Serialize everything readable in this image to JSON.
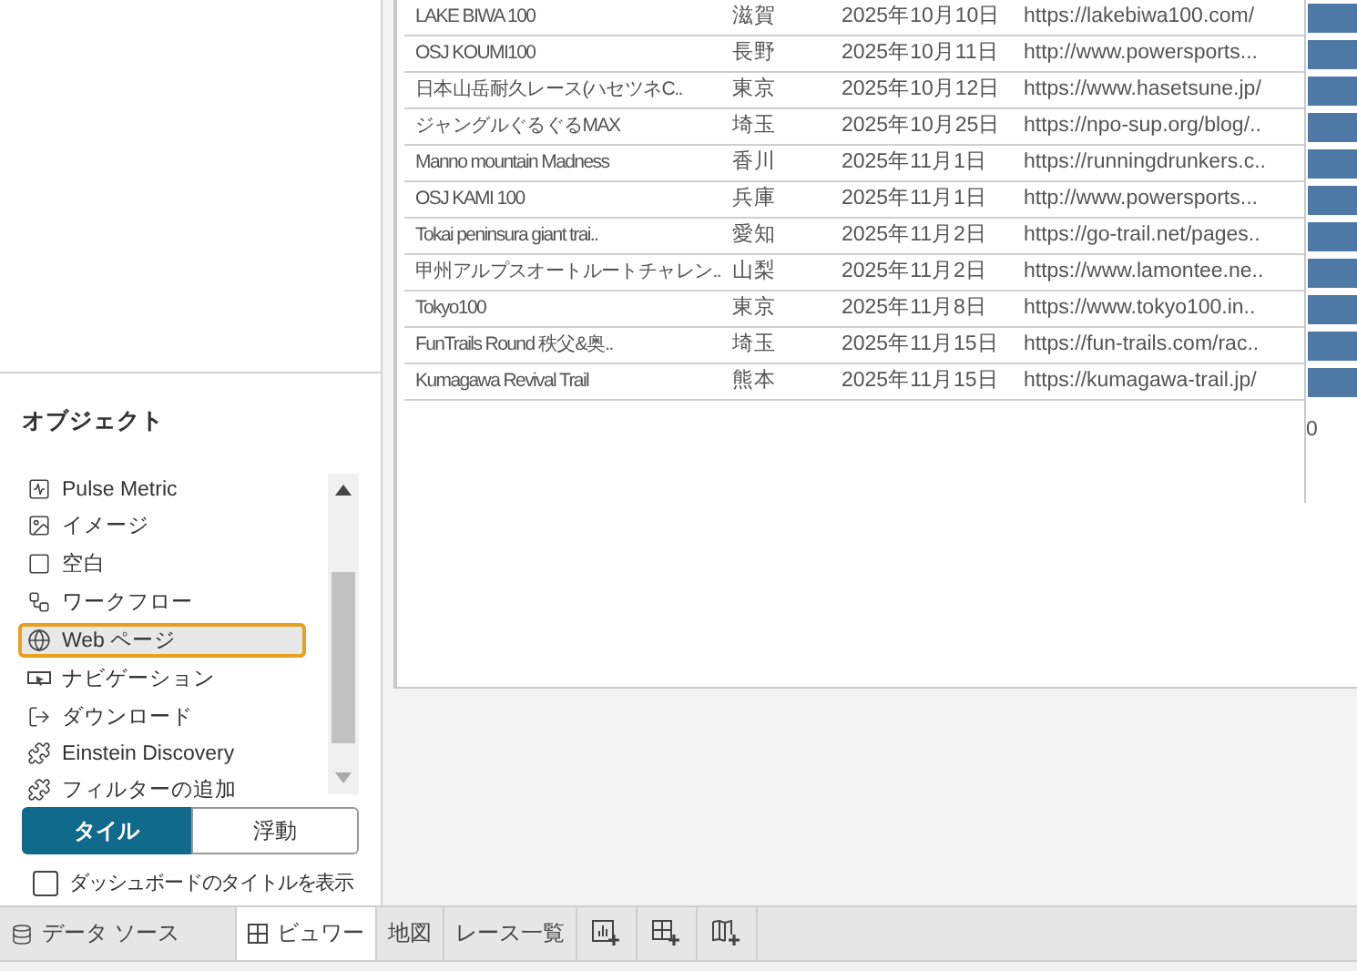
{
  "table": {
    "rows": [
      {
        "name": "LAKE BIWA 100",
        "prefecture": "滋賀",
        "date": "2025年10月10日",
        "url": "https://lakebiwa100.com/"
      },
      {
        "name": "OSJ KOUMI100",
        "prefecture": "長野",
        "date": "2025年10月11日",
        "url": "http://www.powersports..."
      },
      {
        "name": "日本山岳耐久レース(ハセツネC..",
        "prefecture": "東京",
        "date": "2025年10月12日",
        "url": "https://www.hasetsune.jp/"
      },
      {
        "name": "ジャングルぐるぐるMAX",
        "prefecture": "埼玉",
        "date": "2025年10月25日",
        "url": "https://npo-sup.org/blog/.."
      },
      {
        "name": "Manno mountain Madness",
        "prefecture": "香川",
        "date": "2025年11月1日",
        "url": "https://runningdrunkers.c.."
      },
      {
        "name": "OSJ KAMI 100",
        "prefecture": "兵庫",
        "date": "2025年11月1日",
        "url": "http://www.powersports..."
      },
      {
        "name": "Tokai peninsura giant trai..",
        "prefecture": "愛知",
        "date": "2025年11月2日",
        "url": "https://go-trail.net/pages.."
      },
      {
        "name": "甲州アルプスオートルートチャレン..",
        "prefecture": "山梨",
        "date": "2025年11月2日",
        "url": "https://www.lamontee.ne.."
      },
      {
        "name": "Tokyo100",
        "prefecture": "東京",
        "date": "2025年11月8日",
        "url": "https://www.tokyo100.in.."
      },
      {
        "name": "FunTrails Round 秩父&奥..",
        "prefecture": "埼玉",
        "date": "2025年11月15日",
        "url": "https://fun-trails.com/rac.."
      },
      {
        "name": "Kumagawa Revival Trail",
        "prefecture": "熊本",
        "date": "2025年11月15日",
        "url": "https://kumagawa-trail.jp/"
      }
    ],
    "axis_label": "0"
  },
  "objects_panel": {
    "title": "オブジェクト",
    "items": [
      {
        "kind": "pulse",
        "label": "Pulse Metric",
        "selected": false
      },
      {
        "kind": "image",
        "label": "イメージ",
        "selected": false
      },
      {
        "kind": "blank",
        "label": "空白",
        "selected": false
      },
      {
        "kind": "workflow",
        "label": "ワークフロー",
        "selected": false
      },
      {
        "kind": "web",
        "label": "Web ページ",
        "selected": true
      },
      {
        "kind": "navigation",
        "label": "ナビゲーション",
        "selected": false
      },
      {
        "kind": "download",
        "label": "ダウンロード",
        "selected": false
      },
      {
        "kind": "extension",
        "label": "Einstein Discovery",
        "selected": false
      },
      {
        "kind": "extension",
        "label": "フィルターの追加",
        "selected": false
      }
    ],
    "layout_toggle": [
      {
        "label": "タイル",
        "selected": true
      },
      {
        "label": "浮動",
        "selected": false
      }
    ],
    "show_title": {
      "label": "ダッシュボードのタイトルを表示",
      "checked": false
    }
  },
  "sheet_tabs": [
    {
      "kind": "data-source",
      "label": "データ ソース",
      "selected": false
    },
    {
      "kind": "dashboard",
      "label": "ビュワー",
      "selected": true
    },
    {
      "kind": "sheet",
      "label": "地図",
      "selected": false
    },
    {
      "kind": "sheet",
      "label": "レース一覧",
      "selected": false
    },
    {
      "kind": "new-worksheet",
      "selected": false
    },
    {
      "kind": "new-dashboard",
      "selected": false
    },
    {
      "kind": "new-story",
      "selected": false
    }
  ]
}
